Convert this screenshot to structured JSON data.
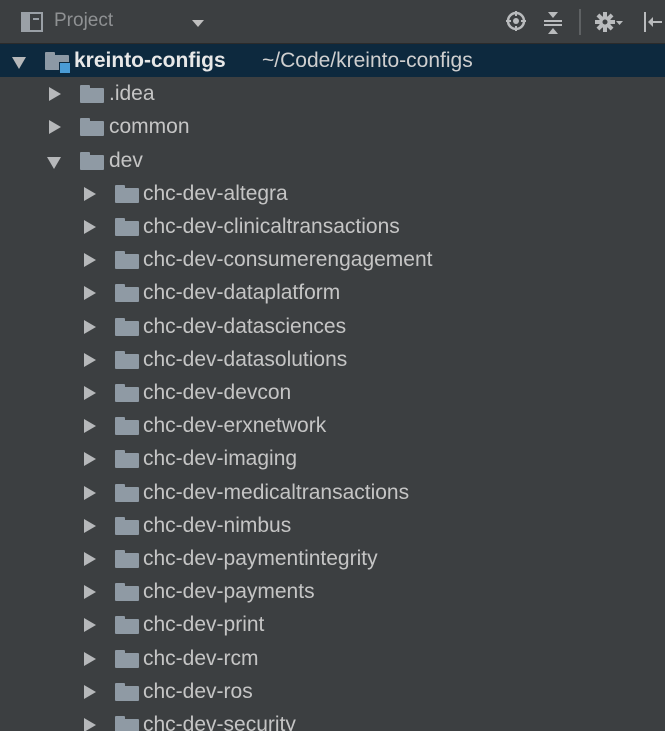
{
  "panel": {
    "title": "Project",
    "icons": [
      "project-view-icon",
      "locate-icon",
      "collapse-all-icon",
      "settings-icon",
      "hide-panel-icon"
    ]
  },
  "tree": {
    "root": {
      "name": "kreinto-configs",
      "path": "~/Code/kreinto-configs",
      "expanded": true
    },
    "level1": [
      {
        "name": ".idea",
        "expanded": false
      },
      {
        "name": "common",
        "expanded": false
      },
      {
        "name": "dev",
        "expanded": true
      }
    ],
    "dev_children": [
      "chc-dev-altegra",
      "chc-dev-clinicaltransactions",
      "chc-dev-consumerengagement",
      "chc-dev-dataplatform",
      "chc-dev-datasciences",
      "chc-dev-datasolutions",
      "chc-dev-devcon",
      "chc-dev-erxnetwork",
      "chc-dev-imaging",
      "chc-dev-medicaltransactions",
      "chc-dev-nimbus",
      "chc-dev-paymentintegrity",
      "chc-dev-payments",
      "chc-dev-print",
      "chc-dev-rcm",
      "chc-dev-ros",
      "chc-dev-security"
    ]
  },
  "colors": {
    "panel_bg": "#3c3f41",
    "selection_bg": "#0d293e",
    "folder": "#8f9aa4",
    "module_badge": "#4a9cd6"
  }
}
